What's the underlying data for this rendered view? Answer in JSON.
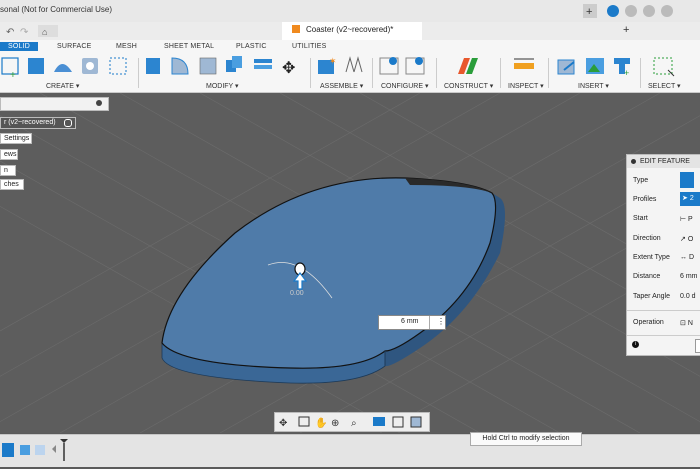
{
  "app": {
    "title": "sonal (Not for Commercial Use)",
    "document_tab": "Coaster (v2~recovered)*"
  },
  "toolbar": {
    "tabs": [
      "SOLID",
      "SURFACE",
      "MESH",
      "SHEET METAL",
      "PLASTIC",
      "UTILITIES"
    ],
    "groups": [
      "CREATE",
      "MODIFY",
      "ASSEMBLE",
      "CONFIGURE",
      "CONSTRUCT",
      "INSPECT",
      "INSERT",
      "SELECT"
    ]
  },
  "browser": {
    "root": "r (v2~recovered)",
    "items": [
      "Settings",
      "ews",
      "n",
      "ches"
    ]
  },
  "edit_feature": {
    "title": "EDIT FEATURE",
    "rows": [
      {
        "label": "Type",
        "value": ""
      },
      {
        "label": "Profiles",
        "value": "2"
      },
      {
        "label": "Start",
        "value": "P"
      },
      {
        "label": "Direction",
        "value": "O"
      },
      {
        "label": "Extent Type",
        "value": "D"
      },
      {
        "label": "Distance",
        "value": "6 mm"
      },
      {
        "label": "Taper Angle",
        "value": "0.0 d"
      },
      {
        "label": "Operation",
        "value": "N"
      }
    ]
  },
  "viewport": {
    "distance_input": "6 mm",
    "manip_label": "0.00"
  },
  "hint": "Hold Ctrl to modify selection",
  "colors": {
    "accent": "#1b7ac9",
    "body": "#3b638f",
    "top": "#4f7ba9"
  }
}
